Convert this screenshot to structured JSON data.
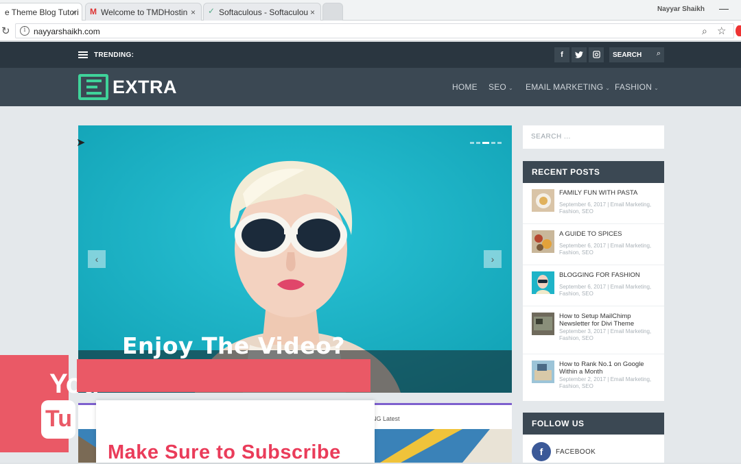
{
  "browser": {
    "tabs": [
      {
        "title": "e Theme Blog Tutori",
        "active": true
      },
      {
        "title": "Welcome to TMDHostin",
        "active": false
      },
      {
        "title": "Softaculous - Softaculou",
        "active": false
      }
    ],
    "close_glyph": "×",
    "profile_name": "Nayyar Shaikh",
    "url": "nayyarshaikh.com",
    "minimize_glyph": "—"
  },
  "topnav": {
    "trending_label": "TRENDING:",
    "social": [
      "f",
      "t",
      "ig"
    ],
    "search_label": "SEARCH"
  },
  "header": {
    "logo_text": "EXTRA",
    "nav": [
      {
        "label": "HOME",
        "has_dropdown": false
      },
      {
        "label": "SEO",
        "has_dropdown": true
      },
      {
        "label": "EMAIL MARKETING",
        "has_dropdown": true
      },
      {
        "label": "FASHION",
        "has_dropdown": true
      }
    ]
  },
  "slider": {
    "title": "Enjoy The Video?",
    "prev_glyph": "‹",
    "next_glyph": "›",
    "accent_color": "#1eb4c8"
  },
  "sidebar": {
    "search_placeholder": "SEARCH ...",
    "recent_posts_title": "RECENT POSTS",
    "recent_posts": [
      {
        "title": "FAMILY FUN WITH PASTA",
        "meta": "September 6, 2017 | Email Marketing, Fashion, SEO"
      },
      {
        "title": "A GUIDE TO SPICES",
        "meta": "September 6, 2017 | Email Marketing, Fashion, SEO"
      },
      {
        "title": "BLOGGING FOR FASHION",
        "meta": "September 6, 2017 | Email Marketing, Fashion, SEO"
      },
      {
        "title": "How to Setup MailChimp Newsletter for Divi Theme",
        "meta": "September 3, 2017 | Email Marketing, Fashion, SEO"
      },
      {
        "title": "How to Rank No.1 on Google Within a Month",
        "meta": "September 2, 2017 | Email Marketing, Fashion, SEO"
      }
    ],
    "follow_title": "FOLLOW US",
    "facebook_label": "FACEBOOK"
  },
  "latest": {
    "label": "NG Latest"
  },
  "overlay": {
    "yt_you": "You",
    "yt_tube": "Tu",
    "subscribe_text": "Make Sure to Subscribe",
    "brand_color": "#ea5966"
  }
}
